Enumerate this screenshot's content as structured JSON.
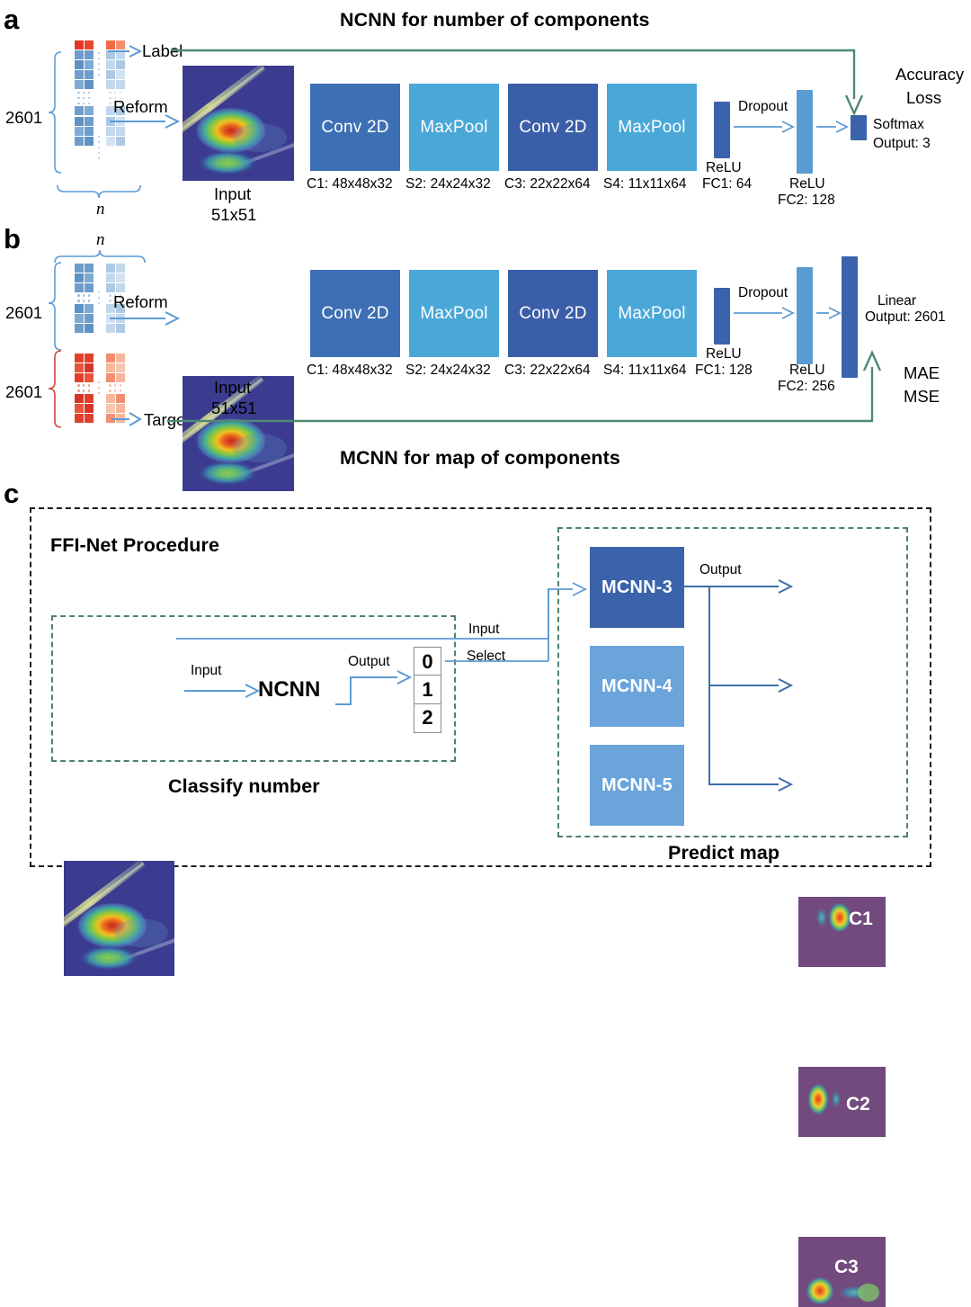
{
  "figure": {
    "panels": [
      "a",
      "b",
      "c"
    ],
    "titles": {
      "panel_a": "NCNN for number of components",
      "panel_b": "MCNN for map of components",
      "panel_c_heading": "FFI-Net Procedure"
    }
  },
  "panel_a": {
    "letter": "a",
    "title": "NCNN for number of components",
    "matrix": {
      "rows_label": "2601",
      "cols_label": "n"
    },
    "arrows": {
      "label": "Label",
      "reform": "Reform"
    },
    "input": {
      "caption": "Input",
      "size": "51x51"
    },
    "layers": [
      {
        "name": "Conv 2D",
        "spec": "C1: 48x48x32",
        "color": "#3d6fb4"
      },
      {
        "name": "MaxPool",
        "spec": "S2: 24x24x32",
        "color": "#4aa8d8"
      },
      {
        "name": "Conv 2D",
        "spec": "C3: 22x22x64",
        "color": "#3a5ea8"
      },
      {
        "name": "MaxPool",
        "spec": "S4: 11x11x64",
        "color": "#4aa8d8"
      }
    ],
    "fc1": {
      "activation": "ReLU",
      "spec": "FC1: 64",
      "color": "#3a63ab"
    },
    "dropout": "Dropout",
    "fc2": {
      "activation": "ReLU",
      "spec": "FC2: 128",
      "color": "#5a9bd4"
    },
    "output": {
      "name": "Softmax",
      "spec": "Output: 3",
      "color": "#3a63ab"
    },
    "metrics": [
      "Accuracy",
      "Loss"
    ]
  },
  "panel_b": {
    "letter": "b",
    "title": "MCNN for map of components",
    "matrix": {
      "rows_label_top": "2601",
      "rows_label_bottom": "2601",
      "cols_label": "n"
    },
    "arrows": {
      "reform": "Reform",
      "target": "Target"
    },
    "input": {
      "caption": "Input",
      "size": "51x51"
    },
    "layers": [
      {
        "name": "Conv 2D",
        "spec": "C1: 48x48x32",
        "color": "#3d6fb4"
      },
      {
        "name": "MaxPool",
        "spec": "S2: 24x24x32",
        "color": "#4aa8d8"
      },
      {
        "name": "Conv 2D",
        "spec": "C3: 22x22x64",
        "color": "#3a5ea8"
      },
      {
        "name": "MaxPool",
        "spec": "S4: 11x11x64",
        "color": "#4aa8d8"
      }
    ],
    "fc1": {
      "activation": "ReLU",
      "spec": "FC1: 128",
      "color": "#3a63ab"
    },
    "dropout": "Dropout",
    "fc2": {
      "activation": "ReLU",
      "spec": "FC2: 256",
      "color": "#5a9bd4"
    },
    "output": {
      "name": "Linear",
      "spec": "Output: 2601",
      "color": "#3a63ab"
    },
    "metrics": [
      "MAE",
      "MSE"
    ]
  },
  "panel_c": {
    "letter": "c",
    "heading": "FFI-Net Procedure",
    "classify": {
      "caption": "Classify number",
      "input_arrow": "Input",
      "model": "NCNN",
      "output_arrow": "Output",
      "classes": [
        "0",
        "1",
        "2"
      ]
    },
    "select_labels": {
      "input": "Input",
      "select": "Select"
    },
    "predict": {
      "caption": "Predict map",
      "output_arrow": "Output",
      "models": [
        {
          "label": "MCNN-3",
          "color": "#3a63ab"
        },
        {
          "label": "MCNN-4",
          "color": "#6aa4da"
        },
        {
          "label": "MCNN-5",
          "color": "#6aa4da"
        }
      ],
      "maps": [
        "C1",
        "C2",
        "C3"
      ]
    }
  },
  "colors": {
    "conv_dark": "#3d6fb4",
    "conv_darker": "#3a5ea8",
    "maxpool_light": "#4aa8d8",
    "fc_dark": "#3a63ab",
    "fc_light": "#5a9bd4",
    "arrow_blue": "#5b9bd5",
    "loss_green": "#4e8a74",
    "map_bg": "#734a7e",
    "heat_bg": "#3b3b8f"
  }
}
